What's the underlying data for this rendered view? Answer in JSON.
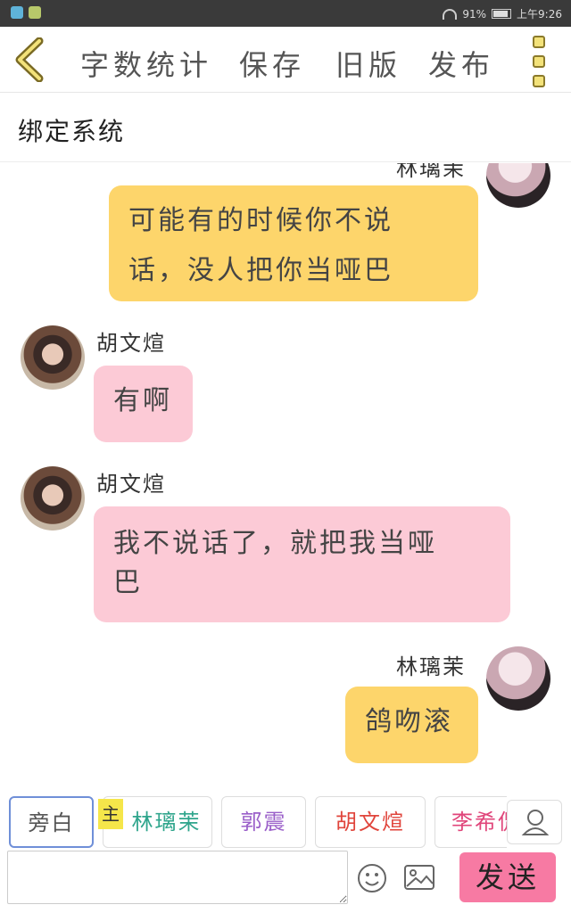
{
  "status_bar": {
    "battery": "91%",
    "time": "上午9:26"
  },
  "toolbar": {
    "word_count": "字数统计",
    "save": "保存",
    "old_version": "旧版",
    "publish": "发布"
  },
  "title": "绑定系统",
  "messages": [
    {
      "side": "right",
      "sender": "林璃茉",
      "text_lines": [
        "可能有的时候你不说",
        "话，没人把你当哑巴"
      ],
      "color": "#fdd56b"
    },
    {
      "side": "left",
      "sender": "胡文煊",
      "text_lines": [
        "有啊"
      ],
      "color": "#fccad6"
    },
    {
      "side": "left",
      "sender": "胡文煊",
      "text_lines": [
        "我不说话了，就把我当哑",
        "巴"
      ],
      "color": "#fccad6"
    },
    {
      "side": "right",
      "sender": "林璃茉",
      "text_lines": [
        "鸽吻滚"
      ],
      "color": "#fdd56b"
    }
  ],
  "roles": [
    {
      "label": "旁白",
      "color": "#555555",
      "selected": true
    },
    {
      "label": "林璃茉",
      "color": "#2fa58c"
    },
    {
      "label": "郭震",
      "color": "#9a5fc9"
    },
    {
      "label": "胡文煊",
      "color": "#e0453c"
    },
    {
      "label": "李希侃",
      "color": "#e0457a"
    }
  ],
  "main_tag": "主",
  "input": {
    "value": "",
    "placeholder": ""
  },
  "send_label": "发送",
  "icons": {
    "back": "chevron-left-icon",
    "menu": "more-vertical-icon",
    "profile": "user-icon",
    "emoji": "smiley-icon",
    "image": "image-icon"
  }
}
